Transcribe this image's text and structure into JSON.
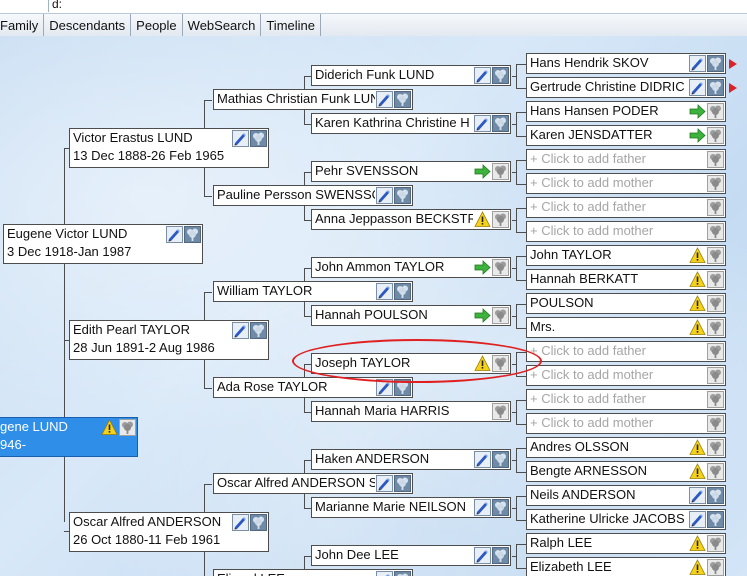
{
  "header": {
    "field_label": "d:"
  },
  "tabs": [
    {
      "label": "Family"
    },
    {
      "label": "Descendants"
    },
    {
      "label": "People"
    },
    {
      "label": "WebSearch"
    },
    {
      "label": "Timeline"
    }
  ],
  "people": {
    "eugene_victor_lund": {
      "name": "Eugene Victor LUND",
      "dates": "3 Dec 1918-Jan 1987"
    },
    "eugene_lund_selected": {
      "name": "gene LUND",
      "dates": "946-"
    },
    "victor_erastus_lund": {
      "name": "Victor Erastus LUND",
      "dates": "13 Dec 1888-26 Feb 1965"
    },
    "edith_pearl_taylor": {
      "name": "Edith Pearl TAYLOR",
      "dates": "28 Jun 1891-2 Aug 1986"
    },
    "oscar_alfred_anderson": {
      "name": "Oscar Alfred ANDERSON",
      "dates": "26 Oct 1880-11 Feb 1961"
    },
    "mathias_lund": {
      "name": "Mathias Christian Funk LUND"
    },
    "pauline_swensson": {
      "name": "Pauline Persson SWENSSON"
    },
    "william_taylor": {
      "name": "William TAYLOR"
    },
    "ada_rose_taylor": {
      "name": "Ada Rose TAYLOR"
    },
    "oscar_alfred_anderson_s": {
      "name": "Oscar Alfred ANDERSON S"
    },
    "bottom_partial": {
      "name": "Eli   and LEE"
    },
    "diderich_lund": {
      "name": "Diderich Funk LUND"
    },
    "karen_kathrina": {
      "name": "Karen Kathrina Christine H"
    },
    "pehr_svensson": {
      "name": "Pehr SVENSSON"
    },
    "anna_beckstrom": {
      "name": "Anna Jeppasson BECKSTR"
    },
    "john_ammon_taylor": {
      "name": "John Ammon TAYLOR"
    },
    "hannah_poulson": {
      "name": "Hannah POULSON"
    },
    "joseph_taylor": {
      "name": "Joseph TAYLOR"
    },
    "hannah_maria_harris": {
      "name": "Hannah Maria HARRIS"
    },
    "haken_anderson": {
      "name": "Haken ANDERSON"
    },
    "marianne_neilson": {
      "name": "Marianne Marie NEILSON"
    },
    "john_dee_lee": {
      "name": "John Dee LEE"
    },
    "hans_hendrik_skov": {
      "name": "Hans Hendrik SKOV"
    },
    "gertrude_didric": {
      "name": "Gertrude Christine DIDRIC"
    },
    "hans_hansen_poder": {
      "name": "Hans Hansen PODER"
    },
    "karen_jensdatter": {
      "name": "Karen JENSDATTER"
    },
    "add_father": {
      "name": "+ Click to add father"
    },
    "add_mother": {
      "name": "+ Click to add mother"
    },
    "john_taylor": {
      "name": "John TAYLOR"
    },
    "hannah_berkatt": {
      "name": "Hannah BERKATT"
    },
    "poulson": {
      "name": "POULSON"
    },
    "mrs": {
      "name": "Mrs."
    },
    "andres_olsson": {
      "name": "Andres OLSSON"
    },
    "bengte_arnesson": {
      "name": "Bengte ARNESSON"
    },
    "neils_anderson": {
      "name": "Neils ANDERSON"
    },
    "katherine_jacobs": {
      "name": "Katherine Ulricke JACOBS"
    },
    "ralph_lee": {
      "name": "Ralph LEE"
    },
    "elizabeth_lee": {
      "name": "Elizabeth LEE"
    }
  },
  "colors": {
    "selected": "#2f8fe8",
    "line": "#4d4d4d",
    "annotation": "#e02020",
    "placeholder_text": "#a5a5a5"
  }
}
